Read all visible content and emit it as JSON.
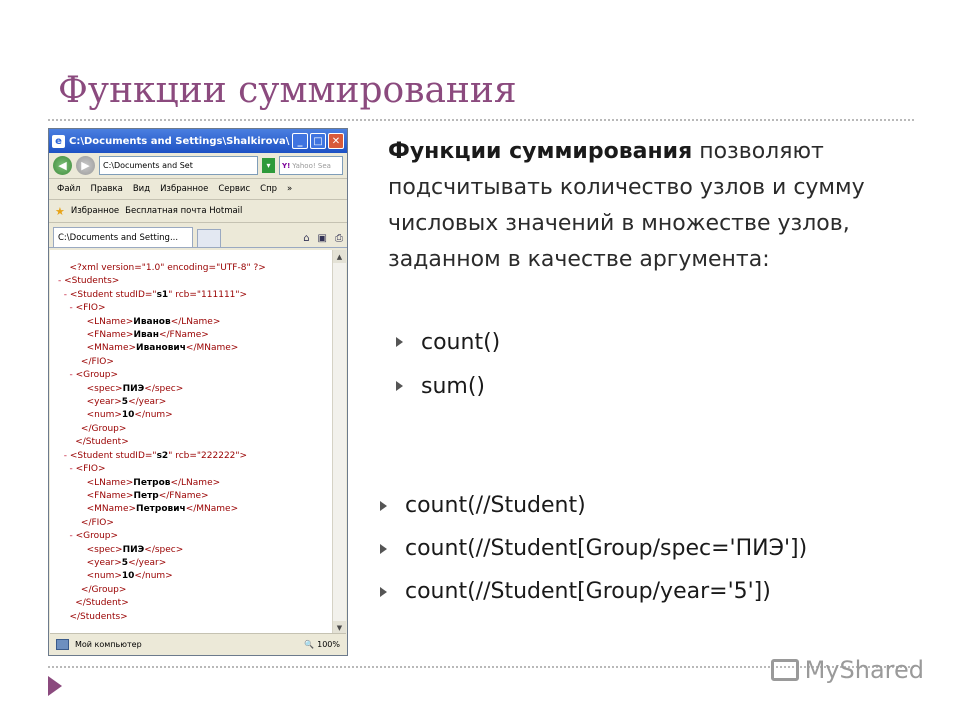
{
  "slide": {
    "title": "Функции суммирования"
  },
  "browser": {
    "title": "C:\\Documents and Settings\\Shalkirova\\Раб...",
    "address": "C:\\Documents and Set",
    "search_placeholder": "Yahoo! Sea",
    "search_brand": "Y!",
    "menu": [
      "Файл",
      "Правка",
      "Вид",
      "Избранное",
      "Сервис",
      "Спр"
    ],
    "favorites_label": "Избранное",
    "favorites_link": "Бесплатная почта Hotmail",
    "tab_title": "C:\\Documents and Setting...",
    "status_text": "Мой компьютер",
    "zoom": "100%",
    "xml_lines": [
      {
        "m": "",
        "open": "<?xml version=\"1.0\" encoding=\"UTF-8\" ?>",
        "val": "",
        "close": "",
        "indent": "  "
      },
      {
        "m": "-",
        "open": "<Students>",
        "val": "",
        "close": "",
        "indent": ""
      },
      {
        "m": "-",
        "open": "<Student studID=\"",
        "val": "s1",
        "close": "\" rcb=\"111111\">",
        "indent": "  "
      },
      {
        "m": "-",
        "open": "<FIO>",
        "val": "",
        "close": "",
        "indent": "    "
      },
      {
        "m": "",
        "open": "<LName>",
        "val": "Иванов",
        "close": "</LName>",
        "indent": "        "
      },
      {
        "m": "",
        "open": "<FName>",
        "val": "Иван",
        "close": "</FName>",
        "indent": "        "
      },
      {
        "m": "",
        "open": "<MName>",
        "val": "Иванович",
        "close": "</MName>",
        "indent": "        "
      },
      {
        "m": "",
        "open": "</FIO>",
        "val": "",
        "close": "",
        "indent": "      "
      },
      {
        "m": "-",
        "open": "<Group>",
        "val": "",
        "close": "",
        "indent": "    "
      },
      {
        "m": "",
        "open": "<spec>",
        "val": "ПИЭ",
        "close": "</spec>",
        "indent": "        "
      },
      {
        "m": "",
        "open": "<year>",
        "val": "5",
        "close": "</year>",
        "indent": "        "
      },
      {
        "m": "",
        "open": "<num>",
        "val": "10",
        "close": "</num>",
        "indent": "        "
      },
      {
        "m": "",
        "open": "</Group>",
        "val": "",
        "close": "",
        "indent": "      "
      },
      {
        "m": "",
        "open": "</Student>",
        "val": "",
        "close": "",
        "indent": "    "
      },
      {
        "m": "-",
        "open": "<Student studID=\"",
        "val": "s2",
        "close": "\" rcb=\"222222\">",
        "indent": "  "
      },
      {
        "m": "-",
        "open": "<FIO>",
        "val": "",
        "close": "",
        "indent": "    "
      },
      {
        "m": "",
        "open": "<LName>",
        "val": "Петров",
        "close": "</LName>",
        "indent": "        "
      },
      {
        "m": "",
        "open": "<FName>",
        "val": "Петр",
        "close": "</FName>",
        "indent": "        "
      },
      {
        "m": "",
        "open": "<MName>",
        "val": "Петрович",
        "close": "</MName>",
        "indent": "        "
      },
      {
        "m": "",
        "open": "</FIO>",
        "val": "",
        "close": "",
        "indent": "      "
      },
      {
        "m": "-",
        "open": "<Group>",
        "val": "",
        "close": "",
        "indent": "    "
      },
      {
        "m": "",
        "open": "<spec>",
        "val": "ПИЭ",
        "close": "</spec>",
        "indent": "        "
      },
      {
        "m": "",
        "open": "<year>",
        "val": "5",
        "close": "</year>",
        "indent": "        "
      },
      {
        "m": "",
        "open": "<num>",
        "val": "10",
        "close": "</num>",
        "indent": "        "
      },
      {
        "m": "",
        "open": "</Group>",
        "val": "",
        "close": "",
        "indent": "      "
      },
      {
        "m": "",
        "open": "</Student>",
        "val": "",
        "close": "",
        "indent": "    "
      },
      {
        "m": "",
        "open": "</Students>",
        "val": "",
        "close": "",
        "indent": "  "
      }
    ]
  },
  "text": {
    "intro_bold": "Функции суммирования",
    "intro_rest": " позволяют подсчитывать количество узлов и сумму числовых значений в множестве узлов, заданном в качестве аргумента:",
    "functions": [
      "count()",
      "sum()"
    ],
    "examples": [
      "count(//Student)",
      "count(//Student[Group/spec='ПИЭ'])",
      "count(//Student[Group/year='5'])"
    ]
  },
  "watermark": "MyShared",
  "colors": {
    "title": "#8b4a7e",
    "xml_tag": "#990000",
    "bullet": "#555555"
  }
}
